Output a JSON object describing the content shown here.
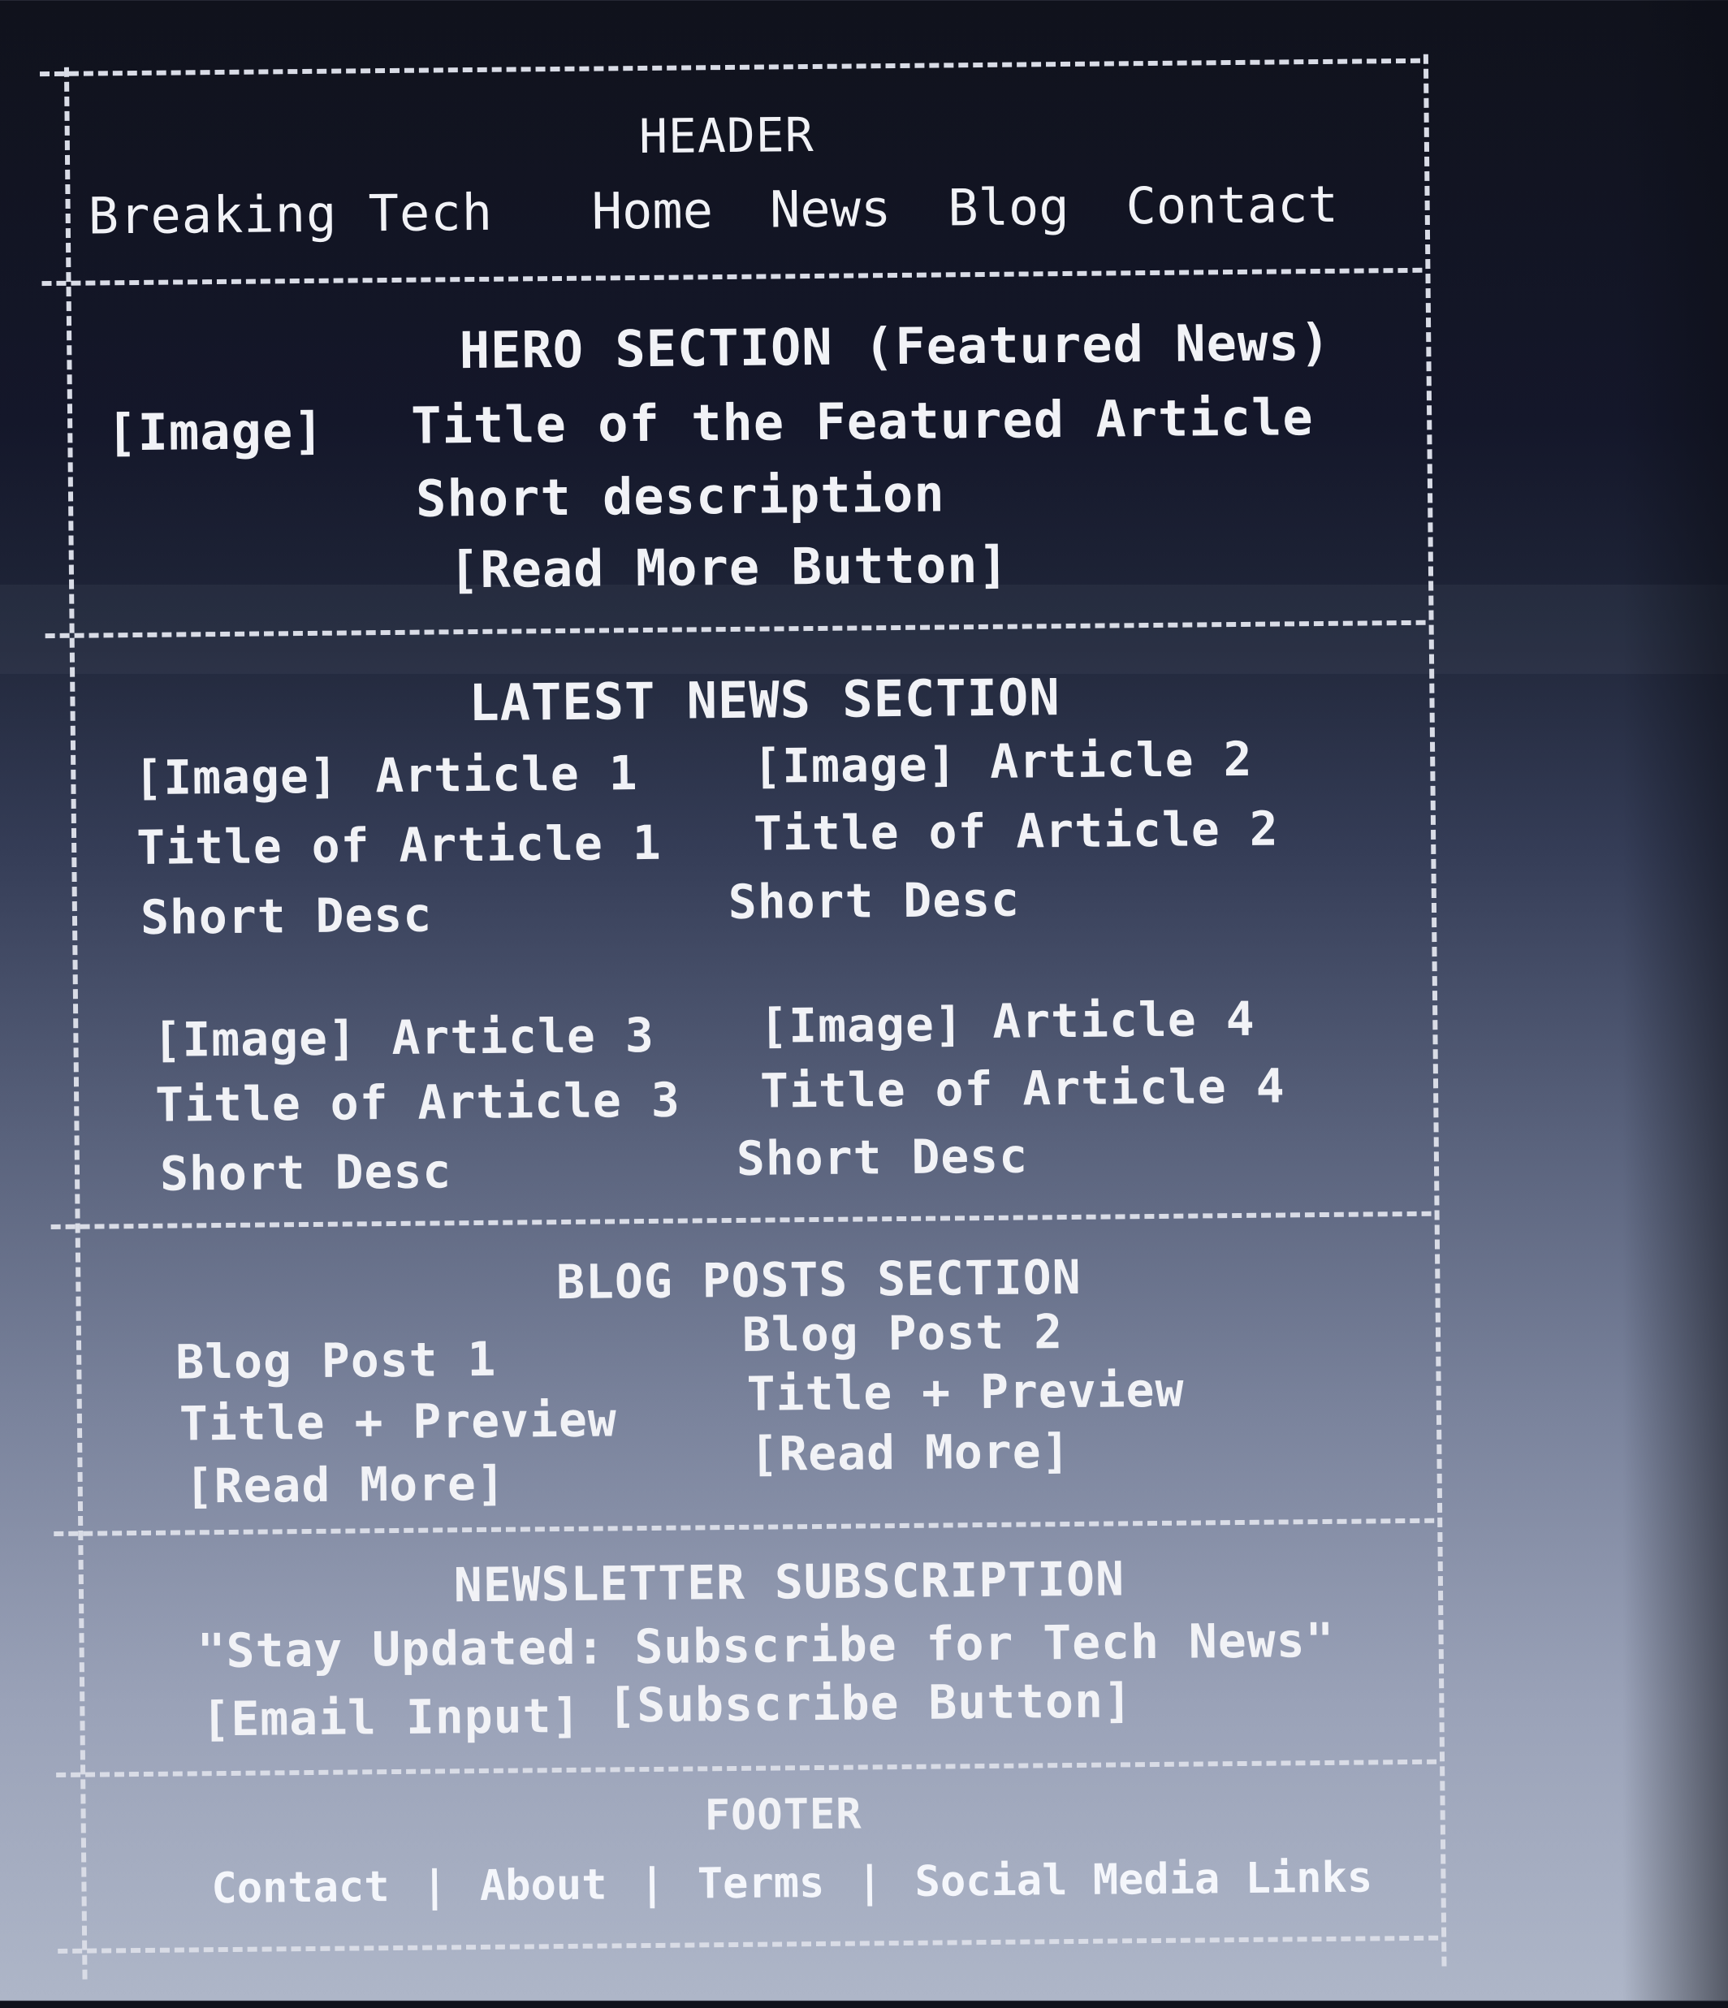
{
  "header": {
    "label": "HEADER",
    "site_title": "Breaking Tech",
    "nav": [
      "Home",
      "News",
      "Blog",
      "Contact"
    ]
  },
  "hero": {
    "label": "HERO SECTION (Featured News)",
    "image": "[Image]",
    "title": "Title of the Featured Article",
    "description": "Short description",
    "button": "[Read More Button]"
  },
  "latest": {
    "label": "LATEST NEWS SECTION",
    "articles": [
      {
        "image": "[Image]",
        "name": "Article 1",
        "title": "Title of Article 1",
        "desc": "Short Desc"
      },
      {
        "image": "[Image]",
        "name": "Article 2",
        "title": "Title of Article 2",
        "desc": "Short Desc"
      },
      {
        "image": "[Image]",
        "name": "Article 3",
        "title": "Title of Article 3",
        "desc": "Short Desc"
      },
      {
        "image": "[Image]",
        "name": "Article 4",
        "title": "Title of Article 4",
        "desc": "Short Desc"
      }
    ]
  },
  "blog": {
    "label": "BLOG POSTS SECTION",
    "posts": [
      {
        "name": "Blog Post 1",
        "preview": "Title + Preview",
        "link": "[Read More]"
      },
      {
        "name": "Blog Post 2",
        "preview": "Title + Preview",
        "link": "[Read More]"
      }
    ]
  },
  "newsletter": {
    "label": "NEWSLETTER SUBSCRIPTION",
    "tagline": "\"Stay Updated: Subscribe for Tech News\"",
    "email_input": "[Email Input]",
    "button": "[Subscribe Button]"
  },
  "footer": {
    "label": "FOOTER",
    "links": [
      "Contact",
      "About",
      "Terms",
      "Social Media Links"
    ],
    "separator": "|"
  }
}
